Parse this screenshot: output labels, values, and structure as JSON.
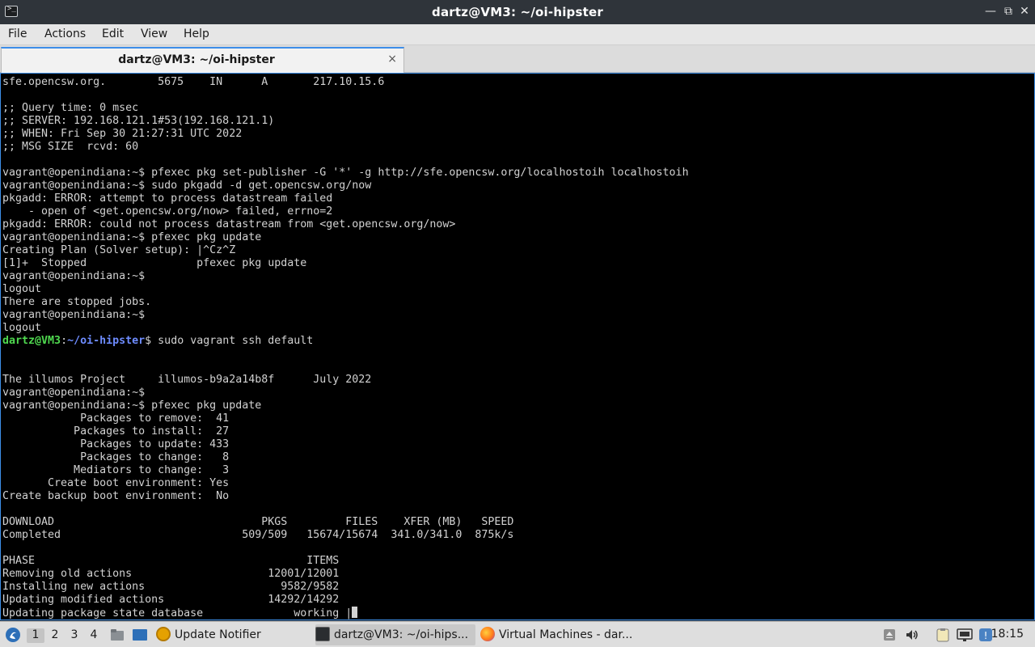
{
  "window": {
    "title": "dartz@VM3: ~/oi-hipster",
    "app_icon": "terminal-icon"
  },
  "menubar": [
    "File",
    "Actions",
    "Edit",
    "View",
    "Help"
  ],
  "tab": {
    "label": "dartz@VM3: ~/oi-hipster",
    "close": "×"
  },
  "terminal": {
    "lines": [
      "sfe.opencsw.org.        5675    IN      A       217.10.15.6",
      "",
      ";; Query time: 0 msec",
      ";; SERVER: 192.168.121.1#53(192.168.121.1)",
      ";; WHEN: Fri Sep 30 21:27:31 UTC 2022",
      ";; MSG SIZE  rcvd: 60",
      "",
      "vagrant@openindiana:~$ pfexec pkg set-publisher -G '*' -g http://sfe.opencsw.org/localhostoih localhostoih",
      "vagrant@openindiana:~$ sudo pkgadd -d get.opencsw.org/now",
      "pkgadd: ERROR: attempt to process datastream failed",
      "    - open of <get.opencsw.org/now> failed, errno=2",
      "pkgadd: ERROR: could not process datastream from <get.opencsw.org/now>",
      "vagrant@openindiana:~$ pfexec pkg update",
      "Creating Plan (Solver setup): |^Cz^Z",
      "[1]+  Stopped                 pfexec pkg update",
      "vagrant@openindiana:~$",
      "logout",
      "There are stopped jobs.",
      "vagrant@openindiana:~$",
      "logout",
      "__PROMPT__",
      "",
      "",
      "The illumos Project     illumos-b9a2a14b8f      July 2022",
      "vagrant@openindiana:~$",
      "vagrant@openindiana:~$ pfexec pkg update",
      "            Packages to remove:  41",
      "           Packages to install:  27",
      "            Packages to update: 433",
      "            Packages to change:   8",
      "           Mediators to change:   3",
      "       Create boot environment: Yes",
      "Create backup boot environment:  No",
      "",
      "DOWNLOAD                                PKGS         FILES    XFER (MB)   SPEED",
      "Completed                            509/509   15674/15674  341.0/341.0  875k/s",
      "",
      "PHASE                                          ITEMS",
      "Removing old actions                     12001/12001",
      "Installing new actions                     9582/9582",
      "Updating modified actions                14292/14292",
      "__LAST__"
    ],
    "prompt": {
      "user": "dartz@VM3",
      "sep": ":",
      "path": "~/oi-hipster",
      "dollar": "$",
      "command": " sudo vagrant ssh default"
    },
    "last_line": "Updating package state database              working |"
  },
  "taskbar": {
    "workspaces": [
      "1",
      "2",
      "3",
      "4"
    ],
    "tasks": [
      {
        "label": "Update Notifier",
        "icon": "update-notifier-icon"
      },
      {
        "label": "dartz@VM3: ~/oi-hips...",
        "icon": "terminal-icon"
      },
      {
        "label": "Virtual Machines - dar...",
        "icon": "firefox-icon"
      }
    ],
    "clock": "18:15"
  }
}
